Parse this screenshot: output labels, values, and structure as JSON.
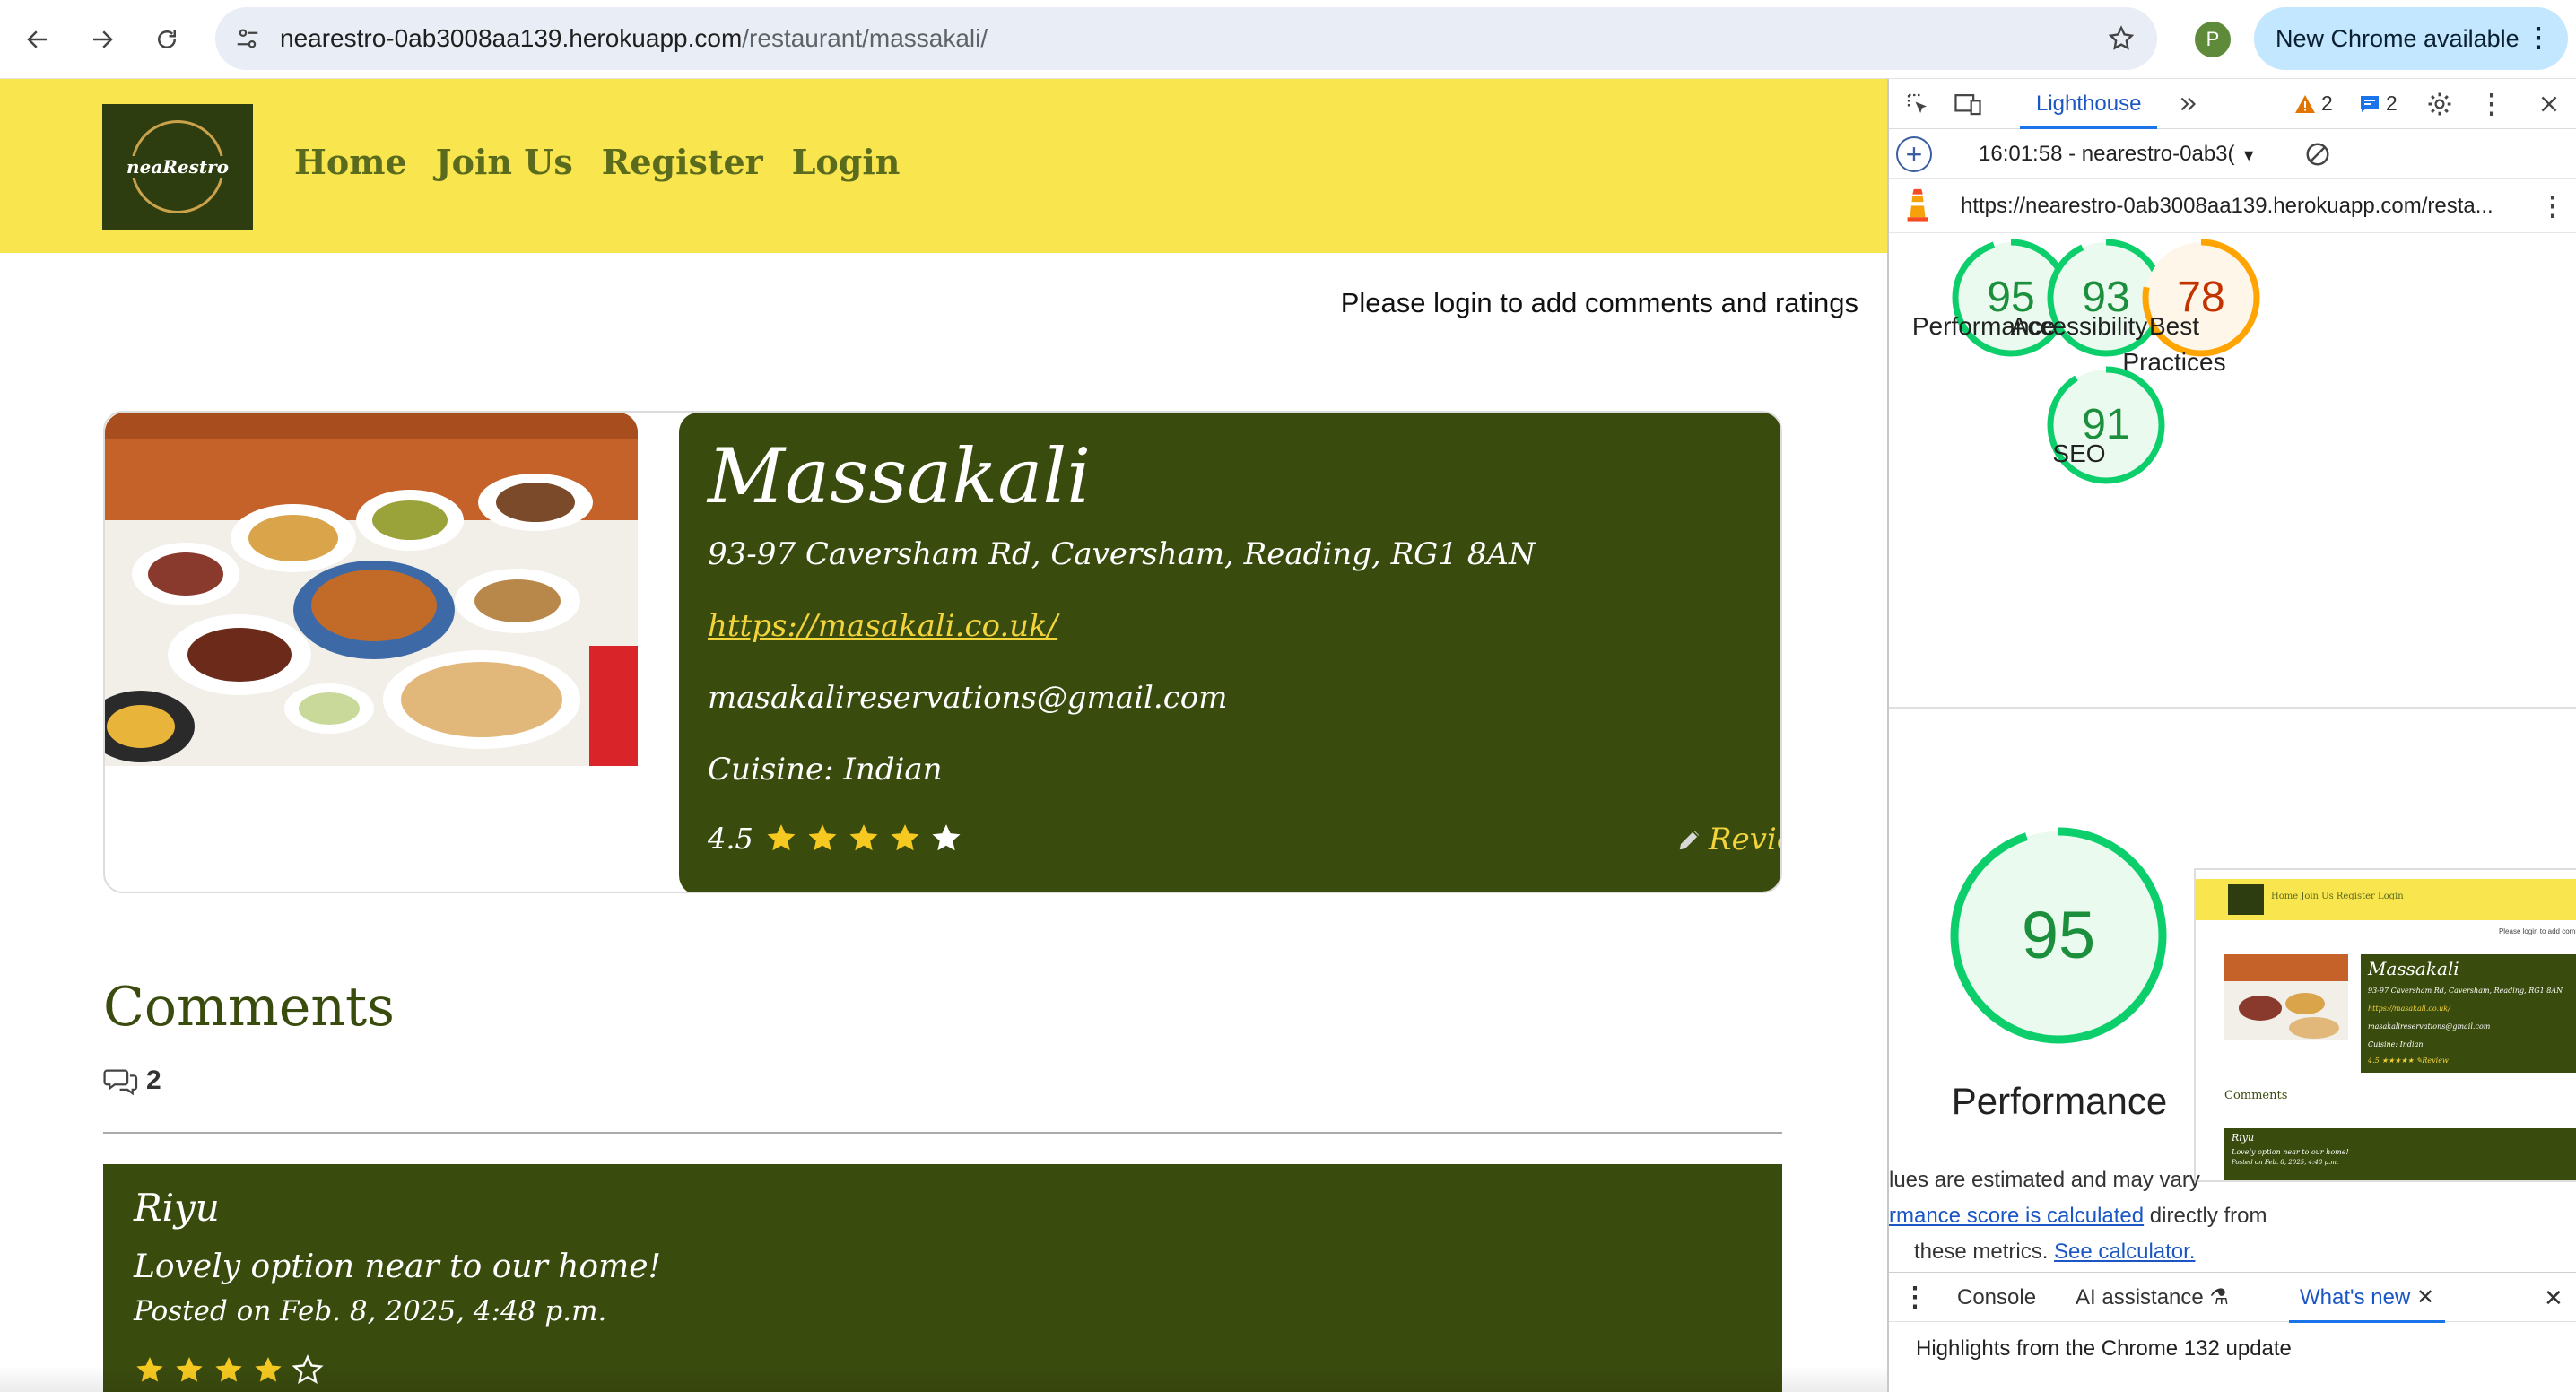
{
  "browser": {
    "url_host": "nearestro-0ab3008aa139.herokuapp.com",
    "url_path": "/restaurant/massakali/",
    "profile_initial": "P",
    "update_button": "New Chrome available"
  },
  "site": {
    "logo_text": "neaRestro",
    "nav": [
      "Home",
      "Join Us",
      "Register",
      "Login"
    ],
    "login_note": "Please login to add comments and ratings",
    "restaurant": {
      "name": "Massakali",
      "address": "93-97 Caversham Rd, Caversham, Reading, RG1 8AN",
      "website": "https://masakali.co.uk/",
      "email": "masakalireservations@gmail.com",
      "cuisine": "Cuisine: Indian",
      "rating_text": "4.5",
      "rating_value": 4.5,
      "review_label": "Review"
    },
    "comments": {
      "title": "Comments",
      "count": "2",
      "items": [
        {
          "author": "Riyu",
          "body": "Lovely option near to our home!",
          "posted": "Posted on Feb. 8, 2025, 4:48 p.m.",
          "stars": 4
        }
      ]
    }
  },
  "devtools": {
    "active_tab": "Lighthouse",
    "warnings": "2",
    "messages": "2",
    "report_label": "16:01:58 - nearestro-0ab3(",
    "report_url": "https://nearestro-0ab3008aa139.herokuapp.com/resta...",
    "scores": [
      {
        "value": 95,
        "label": "Performance",
        "color": "#0cce6b"
      },
      {
        "value": 93,
        "label": "Accessibility",
        "color": "#0cce6b"
      },
      {
        "value": 78,
        "label": "Best Practices",
        "color": "#ffa400"
      },
      {
        "value": 91,
        "label": "SEO",
        "color": "#0cce6b"
      }
    ],
    "main_score": {
      "value": 95,
      "label": "Performance"
    },
    "preview": {
      "nav": "Home   Join Us   Register   Login",
      "note": "Please login to add comm",
      "name": "Massakali",
      "address": "93-97 Caversham Rd, Caversham, Reading, RG1 8AN",
      "website": "https://masakali.co.uk/",
      "email": "masakalireservations@gmail.com",
      "cuisine": "Cuisine: Indian",
      "rating": "4.5 ★★★★★  ✎Review",
      "comments_title": "Comments",
      "comment_author": "Riyu",
      "comment_body": "Lovely option near to our home!",
      "comment_date": "Posted on Feb. 8, 2025, 4:48 p.m."
    },
    "note_line1": "lues are estimated and may vary",
    "note_line2_link": "rmance score is calculated",
    "note_line2_rest": " directly from",
    "note_line3": "these metrics. ",
    "note_line3_link": "See calculator.",
    "drawer": {
      "tabs": [
        "Console",
        "AI assistance",
        "What's new"
      ],
      "message": "Highlights from the Chrome 132 update"
    }
  }
}
